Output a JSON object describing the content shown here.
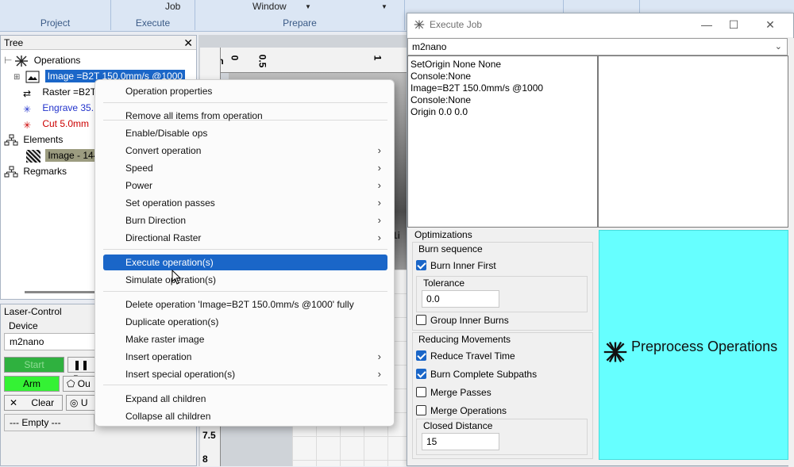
{
  "ribbon": {
    "groups": [
      {
        "label": "Project",
        "top": ""
      },
      {
        "label": "Execute",
        "top": "Job"
      },
      {
        "label": "Prepare",
        "top": "Window"
      }
    ]
  },
  "tree": {
    "title": "Tree",
    "close": "✕",
    "nodes": [
      {
        "label": "Operations"
      },
      {
        "label": "Image =B2T 150.0mm/s @1000"
      },
      {
        "label": "Raster =B2T"
      },
      {
        "label": "Engrave 35."
      },
      {
        "label": "Cut 5.0mm"
      },
      {
        "label": "Elements"
      },
      {
        "label": "Image - 144"
      },
      {
        "label": "Regmarks"
      }
    ]
  },
  "laser": {
    "title": "Laser-Control",
    "device_label": "Device",
    "device_value": "m2nano",
    "start": "Start",
    "pause": "P",
    "arm": "Arm",
    "outline": "Ou",
    "clear": "Clear",
    "update": "U",
    "empty": "--- Empty ---"
  },
  "canvas": {
    "ruler_unit": "inch",
    "ticks": [
      "0",
      "0.5",
      "1"
    ],
    "left_ticks": [
      "7.5",
      "8"
    ],
    "mark": "1i"
  },
  "context_menu": {
    "items": [
      {
        "label": "Operation properties",
        "submenu": false
      },
      {
        "label": "Remove all items from operation",
        "submenu": false
      },
      {
        "label": "Enable/Disable ops",
        "submenu": false
      },
      {
        "label": "Convert operation",
        "submenu": true
      },
      {
        "label": "Speed",
        "submenu": true
      },
      {
        "label": "Power",
        "submenu": true
      },
      {
        "label": "Set operation passes",
        "submenu": true
      },
      {
        "label": "Burn Direction",
        "submenu": true
      },
      {
        "label": "Directional Raster",
        "submenu": true
      },
      {
        "label": "Execute operation(s)",
        "submenu": false
      },
      {
        "label": "Simulate operation(s)",
        "submenu": false
      },
      {
        "label": "Delete operation 'Image=B2T 150.0mm/s @1000' fully",
        "submenu": false
      },
      {
        "label": "Duplicate operation(s)",
        "submenu": false
      },
      {
        "label": "Make raster image",
        "submenu": false
      },
      {
        "label": "Insert operation",
        "submenu": true
      },
      {
        "label": "Insert special operation(s)",
        "submenu": true
      },
      {
        "label": "Expand all children",
        "submenu": false
      },
      {
        "label": "Collapse all children",
        "submenu": false
      }
    ],
    "arrow": "›"
  },
  "exec_job": {
    "title": "Execute Job",
    "minimize": "—",
    "maximize": "☐",
    "close": "✕",
    "device": "m2nano",
    "dropdown_arrow": "⌄",
    "commands": [
      "SetOrigin None None",
      "Console:None",
      "Image=B2T 150.0mm/s @1000",
      "Console:None",
      "Origin 0.0 0.0"
    ],
    "optimizations": {
      "title": "Optimizations",
      "burn_sequence": "Burn sequence",
      "burn_inner_first": {
        "label": "Burn Inner First",
        "checked": true
      },
      "tolerance_label": "Tolerance",
      "tolerance_value": "0.0",
      "group_inner_burns": {
        "label": "Group Inner Burns",
        "checked": false
      },
      "reducing_movements": "Reducing Movements",
      "reduce_travel_time": {
        "label": "Reduce Travel Time",
        "checked": true
      },
      "burn_complete_subpaths": {
        "label": "Burn Complete Subpaths",
        "checked": true
      },
      "merge_passes": {
        "label": "Merge Passes",
        "checked": false
      },
      "merge_operations": {
        "label": "Merge Operations",
        "checked": false
      },
      "closed_distance_label": "Closed Distance",
      "closed_distance_value": "15"
    },
    "preprocess_label": "Preprocess Operations",
    "accent": "#66ffff"
  }
}
